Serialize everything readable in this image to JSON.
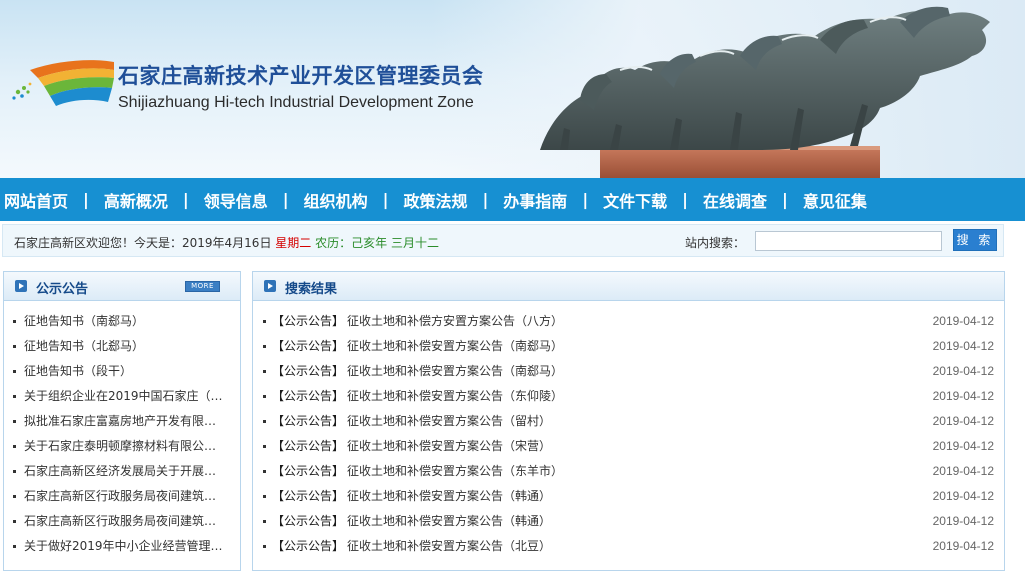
{
  "site": {
    "title_cn": "石家庄高新技术产业开发区管理委员会",
    "title_en": "Shijiazhuang Hi-tech Industrial Development Zone"
  },
  "nav": [
    {
      "label": "网站首页"
    },
    {
      "label": "高新概况"
    },
    {
      "label": "领导信息"
    },
    {
      "label": "组织机构"
    },
    {
      "label": "政策法规"
    },
    {
      "label": "办事指南"
    },
    {
      "label": "文件下载"
    },
    {
      "label": "在线调查"
    },
    {
      "label": "意见征集"
    }
  ],
  "nav_separator": "|",
  "infobar": {
    "welcome_prefix": "石家庄高新区欢迎您！今天是：2019年4月16日",
    "weekday": "星期二",
    "lunar_label": "农历：",
    "lunar_date": "己亥年 三月十二",
    "search_label": "站内搜索：",
    "search_value": "",
    "search_button": "搜 索"
  },
  "left_panel": {
    "title": "公示公告",
    "more_label": "MORE",
    "items": [
      "征地告知书（南郄马）",
      "征地告知书（北郄马）",
      "征地告知书（段干）",
      "关于组织企业在2019中国石家庄（…",
      "拟批准石家庄富嘉房地产开发有限…",
      "关于石家庄泰明顿摩擦材料有限公…",
      "石家庄高新区经济发展局关于开展…",
      "石家庄高新区行政服务局夜间建筑…",
      "石家庄高新区行政服务局夜间建筑…",
      "关于做好2019年中小企业经营管理…"
    ]
  },
  "right_panel": {
    "title": "搜索结果",
    "results": [
      {
        "tag": "【公示公告】",
        "title": "征收土地和补偿方安置方案公告（八方）",
        "date": "2019-04-12"
      },
      {
        "tag": "【公示公告】",
        "title": "征收土地和补偿安置方案公告（南郄马）",
        "date": "2019-04-12"
      },
      {
        "tag": "【公示公告】",
        "title": "征收土地和补偿安置方案公告（南郄马）",
        "date": "2019-04-12"
      },
      {
        "tag": "【公示公告】",
        "title": "征收土地和补偿安置方案公告（东仰陵）",
        "date": "2019-04-12"
      },
      {
        "tag": "【公示公告】",
        "title": "征收土地和补偿安置方案公告（留村）",
        "date": "2019-04-12"
      },
      {
        "tag": "【公示公告】",
        "title": "征收土地和补偿安置方案公告（宋营）",
        "date": "2019-04-12"
      },
      {
        "tag": "【公示公告】",
        "title": "征收土地和补偿安置方案公告（东羊市）",
        "date": "2019-04-12"
      },
      {
        "tag": "【公示公告】",
        "title": "征收土地和补偿安置方案公告（韩通）",
        "date": "2019-04-12"
      },
      {
        "tag": "【公示公告】",
        "title": "征收土地和补偿安置方案公告（韩通）",
        "date": "2019-04-12"
      },
      {
        "tag": "【公示公告】",
        "title": "征收土地和补偿安置方案公告（北豆）",
        "date": "2019-04-12"
      }
    ]
  },
  "colors": {
    "nav_bg": "#1790d2",
    "title_blue": "#1f4f98",
    "weekday_red": "#d40000",
    "lunar_green": "#2a8c2a",
    "button_blue": "#2a7fd0"
  }
}
